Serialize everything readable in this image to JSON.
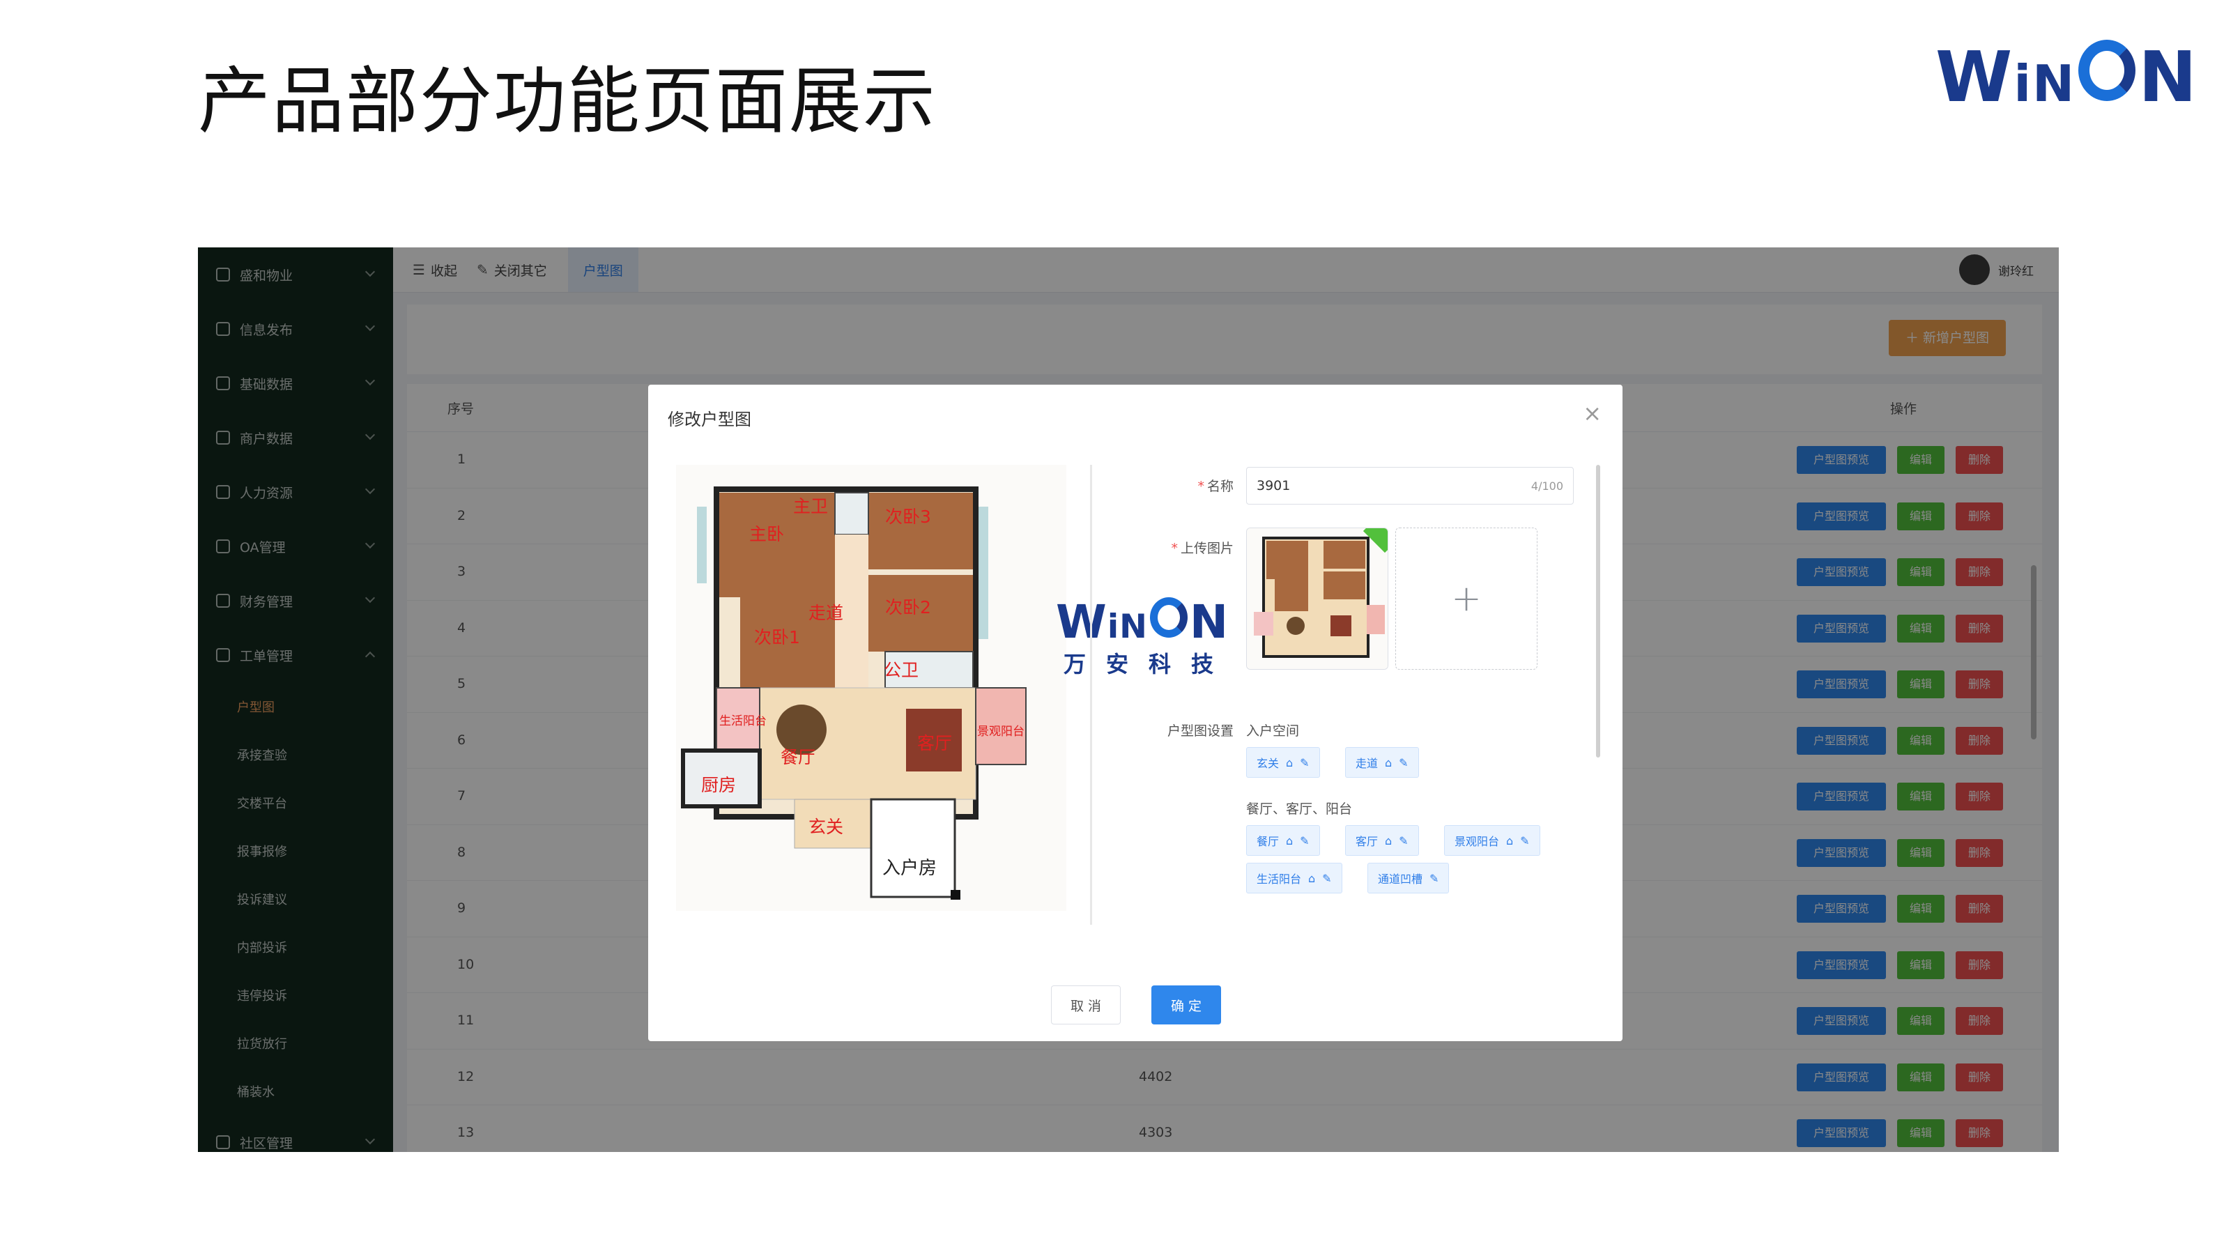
{
  "slide": {
    "title": "产品部分功能页面展示",
    "logo_text": {
      "w": "W",
      "i": "i",
      "n": "N",
      "n2": "N"
    }
  },
  "colors": {
    "brand": "#1a3a8c",
    "accent": "#1a6fd8",
    "sidebar": "#142a1f",
    "primary": "#2f87ec",
    "success": "#52c03c",
    "danger": "#f05050",
    "warning": "#f1a24f"
  },
  "sidebar": {
    "items": [
      {
        "label": "盛和物业",
        "icon": "home-icon"
      },
      {
        "label": "信息发布",
        "icon": "edit-doc-icon"
      },
      {
        "label": "基础数据",
        "icon": "database-icon"
      },
      {
        "label": "商户数据",
        "icon": "store-icon"
      },
      {
        "label": "人力资源",
        "icon": "people-icon"
      },
      {
        "label": "OA管理",
        "icon": "oa-icon"
      },
      {
        "label": "财务管理",
        "icon": "finance-icon"
      },
      {
        "label": "工单管理",
        "icon": "workorder-icon"
      }
    ],
    "sub_items": [
      "户型图",
      "承接查验",
      "交楼平台",
      "报事报修",
      "投诉建议",
      "内部投诉",
      "违停投诉",
      "拉货放行",
      "桶装水"
    ],
    "last_item": "社区管理"
  },
  "topbar": {
    "collapse": "收起",
    "close_others": "关闭其它",
    "active_tab": "户型图",
    "user": "谢玲红"
  },
  "toolbar": {
    "add_button": "新增户型图"
  },
  "table": {
    "headers": {
      "index": "序号",
      "ops": "操作"
    },
    "rows": [
      {
        "idx": "1",
        "name": ""
      },
      {
        "idx": "2",
        "name": ""
      },
      {
        "idx": "3",
        "name": ""
      },
      {
        "idx": "4",
        "name": ""
      },
      {
        "idx": "5",
        "name": ""
      },
      {
        "idx": "6",
        "name": ""
      },
      {
        "idx": "7",
        "name": ""
      },
      {
        "idx": "8",
        "name": ""
      },
      {
        "idx": "9",
        "name": ""
      },
      {
        "idx": "10",
        "name": ""
      },
      {
        "idx": "11",
        "name": ""
      },
      {
        "idx": "12",
        "name": "4402"
      },
      {
        "idx": "13",
        "name": "4303"
      }
    ],
    "ops": {
      "preview": "户型图预览",
      "edit": "编辑",
      "delete": "删除"
    }
  },
  "dialog": {
    "title": "修改户型图",
    "close": "×",
    "plan_labels": {
      "master_bath": "主卫",
      "bedroom_main": "主卧",
      "bedroom3": "次卧3",
      "bedroom2": "次卧2",
      "bedroom1": "次卧1",
      "corridor": "走道",
      "public_bath": "公卫",
      "life_balcony": "生活阳台",
      "dining": "餐厅",
      "living": "客厅",
      "view_balcony": "景观阳台",
      "kitchen": "厨房",
      "entrance": "玄关",
      "entry_room": "入户房"
    },
    "brand_cn": "万安科技",
    "form": {
      "name_label": "名称",
      "name_value": "3901",
      "name_counter": "4/100",
      "upload_label": "上传图片",
      "upload_plus": "+",
      "setting_label": "户型图设置"
    },
    "groups": [
      {
        "title": "入户空间",
        "tags": [
          {
            "label": "玄关"
          },
          {
            "label": "走道"
          }
        ]
      },
      {
        "title": "餐厅、客厅、阳台",
        "tags": [
          {
            "label": "餐厅"
          },
          {
            "label": "客厅"
          },
          {
            "label": "景观阳台"
          },
          {
            "label": "生活阳台"
          },
          {
            "label": "通道凹槽"
          }
        ]
      }
    ],
    "buttons": {
      "cancel": "取 消",
      "ok": "确 定"
    }
  }
}
